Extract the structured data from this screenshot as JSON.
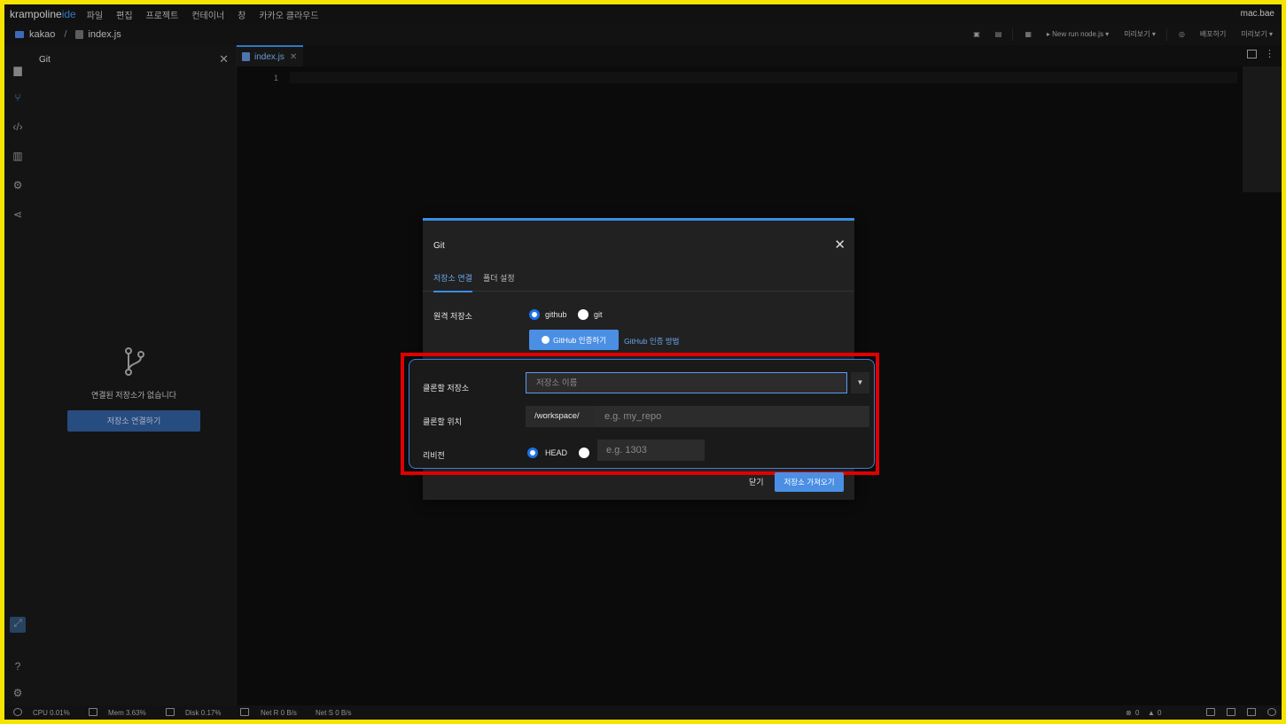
{
  "app": {
    "brand": "krampoline",
    "brand_suffix": "ide",
    "user": "mac.bae"
  },
  "menu": [
    "파일",
    "편집",
    "프로젝트",
    "컨테이너",
    "창",
    "카카오 클라우드"
  ],
  "breadcrumb": {
    "project": "kakao",
    "separator": "/",
    "file": "index.js"
  },
  "toolbar": {
    "run_label": "▸ New run node.js ▾",
    "preview1": "미리보기 ▾",
    "deploy": "배포하기",
    "preview2": "미리보기 ▾"
  },
  "side_panel": {
    "title": "Git",
    "empty_message": "연결된 저장소가 없습니다",
    "connect_button": "저장소 연결하기"
  },
  "editor": {
    "tab": "index.js",
    "line_number": "1"
  },
  "status": {
    "cpu": "CPU 0.01%",
    "mem": "Mem 3.63%",
    "disk": "Disk 0.17%",
    "net_r": "Net R 0 B/s",
    "net_s": "Net S 0 B/s",
    "errors": "0",
    "warnings": "0"
  },
  "modal": {
    "title": "Git",
    "tabs": [
      "저장소 연결",
      "폴더 설정"
    ],
    "remote_label": "원격 저장소",
    "remote_options": [
      "github",
      "git"
    ],
    "remote_selected": "github",
    "github_auth_button": "GitHub 인증하기",
    "github_auth_guide": "GitHub 인증 방법",
    "clone_repo_label": "클론할 저장소",
    "clone_repo_placeholder": "저장소 이름",
    "clone_location_label": "클론할 위치",
    "clone_location_prefix": "/workspace/",
    "clone_location_placeholder": "e.g. my_repo",
    "revision_label": "리비전",
    "revision_options": [
      "HEAD",
      ""
    ],
    "revision_selected": "HEAD",
    "revision_placeholder": "e.g. 1303",
    "close_button": "닫기",
    "fetch_button": "저장소 가져오기"
  },
  "colors": {
    "accent": "#3a8ee6",
    "highlight": "#e00000",
    "frame": "#f5e400"
  }
}
